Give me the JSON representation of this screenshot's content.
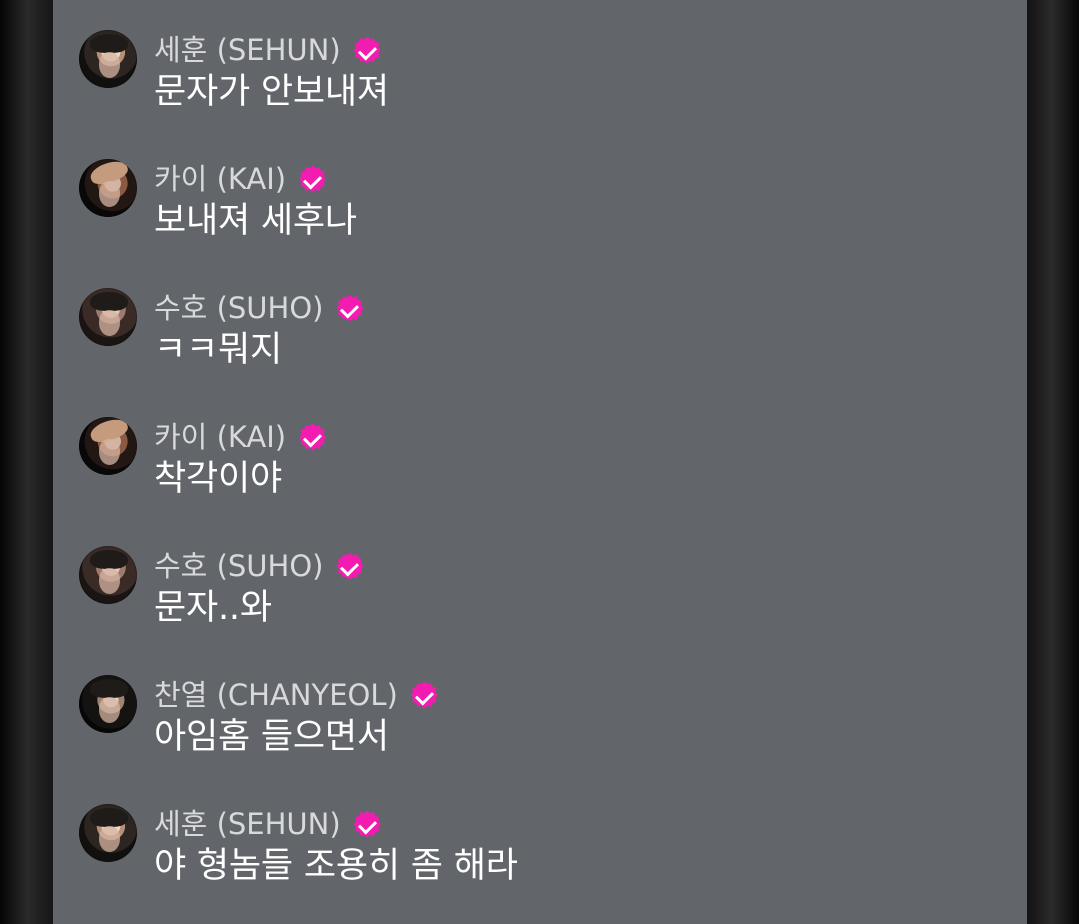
{
  "messages": [
    {
      "author": "세훈 (SEHUN)",
      "avatar": "sehun-avatar",
      "text": "문자가 안보내져"
    },
    {
      "author": "카이 (KAI)",
      "avatar": "kai-avatar",
      "text": "보내져 세후나"
    },
    {
      "author": "수호 (SUHO)",
      "avatar": "suho-avatar",
      "text": "ㅋㅋ뭐지"
    },
    {
      "author": "카이 (KAI)",
      "avatar": "kai-avatar",
      "text": "착각이야"
    },
    {
      "author": "수호 (SUHO)",
      "avatar": "suho-avatar",
      "text": "문자..와"
    },
    {
      "author": "찬열 (CHANYEOL)",
      "avatar": "chanyeol-avatar",
      "text": "아임홈 들으면서"
    },
    {
      "author": "세훈 (SEHUN)",
      "avatar": "sehun-avatar",
      "text": "야 형놈들 조용히 좀 해라"
    }
  ],
  "colors": {
    "panel_background": "#626569",
    "author_text": "#d8d9db",
    "message_text": "#ffffff",
    "verified_badge": "#f21cb1"
  },
  "icons": {
    "verified": "verified-badge-icon"
  }
}
